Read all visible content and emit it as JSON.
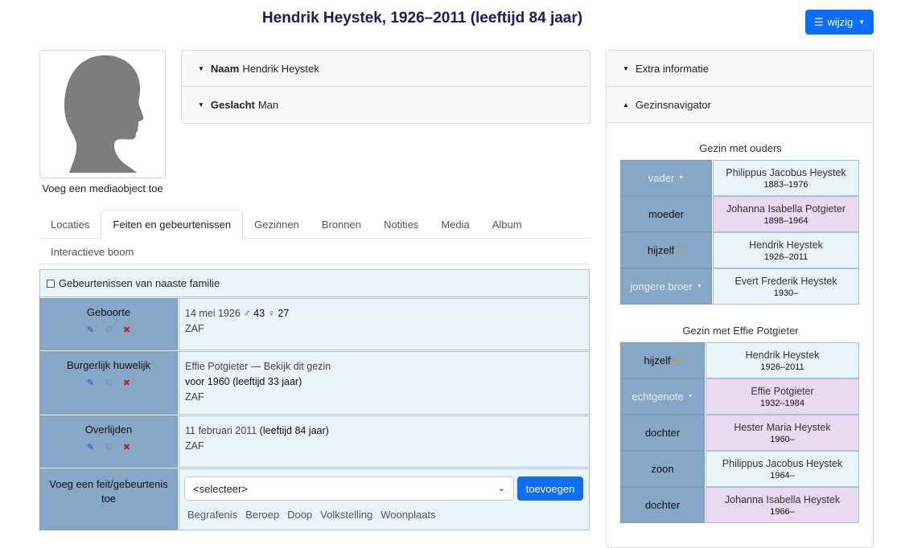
{
  "header": {
    "title": "Hendrik Heystek, 1926–2011 (leeftijd 84 jaar)",
    "edit_label": "wijzig"
  },
  "media": {
    "caption": "Voeg een mediaobject toe"
  },
  "person": {
    "name_label": "Naam",
    "name_value": "Hendrik Heystek",
    "gender_label": "Geslacht",
    "gender_value": "Man"
  },
  "tabs": [
    {
      "label": "Locaties"
    },
    {
      "label": "Feiten en gebeurtenissen"
    },
    {
      "label": "Gezinnen"
    },
    {
      "label": "Bronnen"
    },
    {
      "label": "Notities"
    },
    {
      "label": "Media"
    },
    {
      "label": "Album"
    },
    {
      "label": "Interactieve boom"
    }
  ],
  "facts": {
    "family_checkbox_label": "Gebeurtenissen van naaste familie",
    "birth": {
      "label": "Geboorte",
      "date": "14 mei 1926",
      "father_age": "43",
      "mother_age": "27",
      "place": "ZAF"
    },
    "marriage": {
      "label": "Burgerlijk huwelijk",
      "spouse": "Effie Potgieter",
      "separator": "—",
      "family_link": "Bekijk dit gezin",
      "date": "voor 1960",
      "age": "(leeftijd 33 jaar)",
      "place": "ZAF"
    },
    "death": {
      "label": "Overlijden",
      "date": "11 februari 2011",
      "age": "(leeftijd 84 jaar)",
      "place": "ZAF"
    },
    "add": {
      "label": "Voeg een feit/gebeurtenis toe",
      "select_value": "<selecteer>",
      "button_label": "toevoegen",
      "quick_links": [
        "Begrafenis",
        "Beroep",
        "Doop",
        "Volkstelling",
        "Woonplaats"
      ]
    }
  },
  "sidebar": {
    "extra_info_label": "Extra informatie",
    "navigator_label": "Gezinsnavigator",
    "parents_family": {
      "title": "Gezin met ouders",
      "rows": [
        {
          "role": "vader",
          "name": "Philippus Jacobus Heystek",
          "years": "1883–1976"
        },
        {
          "role": "moeder",
          "name": "Johanna Isabella Potgieter",
          "years": "1898–1964"
        },
        {
          "role": "hijzelf",
          "name": "Hendrik Heystek",
          "years": "1926–2011"
        },
        {
          "role": "jongere broer",
          "name": "Evert Frederik Heystek",
          "years": "1930–"
        }
      ]
    },
    "spouse_family": {
      "title": "Gezin met Effie Potgieter",
      "rows": [
        {
          "role": "hijzelf",
          "name": "Hendrik Heystek",
          "years": "1926–2011"
        },
        {
          "role": "echtgenote",
          "name": "Effie Potgieter",
          "years": "1932–1984"
        },
        {
          "role": "dochter",
          "name": "Hester Maria Heystek",
          "years": "1960–"
        },
        {
          "role": "zoon",
          "name": "Philippus Jacobus Heystek",
          "years": "1964–"
        },
        {
          "role": "dochter",
          "name": "Johanna Isabella Heystek",
          "years": "1966–"
        }
      ]
    }
  }
}
